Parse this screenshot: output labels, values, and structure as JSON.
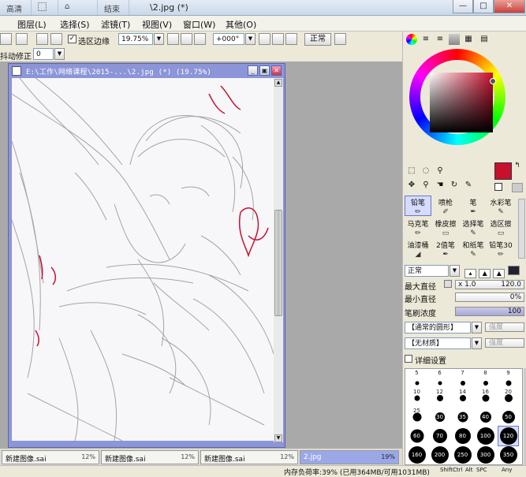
{
  "titlebar": {
    "tabs": [
      "高清",
      "",
      "",
      "结束"
    ],
    "doc_title": "\\2.jpg (*)",
    "window_buttons": [
      "—",
      "□",
      "✕"
    ]
  },
  "menubar": {
    "items": [
      "图层(L)",
      "选择(S)",
      "滤镜(T)",
      "视图(V)",
      "窗口(W)",
      "其他(O)"
    ]
  },
  "toolbar": {
    "selection_edge_label": "选区边缘",
    "zoom_value": "19.75%",
    "rotation_value": "+000°",
    "mode_label": "正常"
  },
  "toolbar2": {
    "stabilizer_label": "抖动修正",
    "stabilizer_value": "0"
  },
  "document": {
    "title": "E:\\工作\\网络课程\\2015-...\\2.jpg (*) (19.75%)",
    "line_color": "#9a9a9a",
    "accent_color": "#c8102e"
  },
  "tabs": [
    {
      "name": "新建图像.sai",
      "pct": "12%"
    },
    {
      "name": "新建图像.sai",
      "pct": "12%"
    },
    {
      "name": "新建图像.sai",
      "pct": "12%"
    },
    {
      "name": "2.jpg",
      "pct": "19%",
      "active": true
    }
  ],
  "status": {
    "memory": "内存负荷率:39% (已用364MB/可用1031MB)",
    "keys": [
      "Shift",
      "Ctrl",
      "Alt",
      "SPC",
      "Any"
    ]
  },
  "colors": {
    "primary": "#c8102e",
    "secondary": "#ffffff"
  },
  "brushes": [
    {
      "label": "铅笔",
      "icon": "pencil-icon",
      "sel": true
    },
    {
      "label": "喷枪",
      "icon": "airbrush-icon"
    },
    {
      "label": "笔",
      "icon": "pen-icon"
    },
    {
      "label": "水彩笔",
      "icon": "watercolor-icon"
    },
    {
      "label": "马克笔",
      "icon": "marker-icon"
    },
    {
      "label": "橡皮擦",
      "icon": "eraser-icon"
    },
    {
      "label": "选择笔",
      "icon": "select-pen-icon"
    },
    {
      "label": "选区擦",
      "icon": "select-eraser-icon"
    },
    {
      "label": "油漆桶",
      "icon": "bucket-icon"
    },
    {
      "label": "2值笔",
      "icon": "binary-pen-icon"
    },
    {
      "label": "和纸笔",
      "icon": "washi-pen-icon"
    },
    {
      "label": "铅笔30",
      "icon": "pencil-icon"
    }
  ],
  "brush_settings": {
    "mode": "正常",
    "max_size_label": "最大直径",
    "max_size_mult": "x 1.0",
    "max_size_value": "120.0",
    "min_size_label": "最小直径",
    "min_size_value": "0%",
    "density_label": "笔刷浓度",
    "density_value": "100",
    "shape": "【通常的圆形】",
    "shape_strength": "强度",
    "texture": "【无材质】",
    "texture_strength": "强度",
    "detail_label": "详细设置"
  },
  "sizes": [
    "5",
    "6",
    "7",
    "8",
    "9",
    "10",
    "12",
    "14",
    "16",
    "20",
    "25",
    "30",
    "35",
    "40",
    "50",
    "60",
    "70",
    "80",
    "100",
    "120",
    "160",
    "200",
    "250",
    "300",
    "350"
  ]
}
